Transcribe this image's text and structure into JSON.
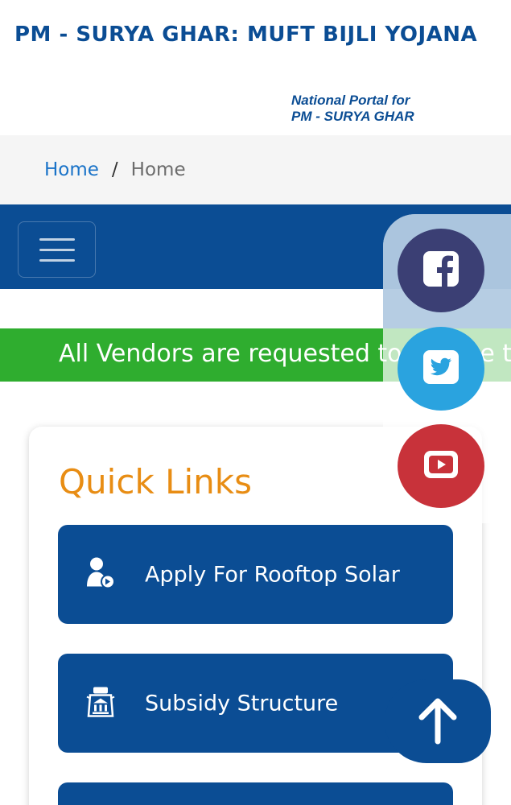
{
  "header": {
    "site_title": "PM - SURYA GHAR: MUFT BIJLI YOJANA",
    "portal_line1": "National Portal for",
    "portal_line2": "PM - SURYA GHAR"
  },
  "breadcrumb": {
    "home_label": "Home",
    "separator": "/",
    "current_label": "Home"
  },
  "navbar": {
    "menu_icon": "hamburger-icon"
  },
  "ticker": {
    "text": "All Vendors are requested to update their"
  },
  "social": [
    {
      "name": "facebook",
      "icon": "facebook-icon",
      "color": "#3b3f74"
    },
    {
      "name": "twitter",
      "icon": "twitter-icon",
      "color": "#2aa3df"
    },
    {
      "name": "youtube",
      "icon": "youtube-icon",
      "color": "#c8323a"
    }
  ],
  "quick_links": {
    "title": "Quick Links",
    "items": [
      {
        "label": "Apply For Rooftop Solar",
        "icon": "user-apply-icon"
      },
      {
        "label": "Subsidy Structure",
        "icon": "subsidy-icon"
      },
      {
        "label": "",
        "icon": ""
      }
    ]
  },
  "colors": {
    "primary": "#0b4d94",
    "accent": "#e88d14",
    "ticker": "#2fad2f",
    "link": "#1a73c8"
  },
  "scroll_top_icon": "arrow-up-icon"
}
